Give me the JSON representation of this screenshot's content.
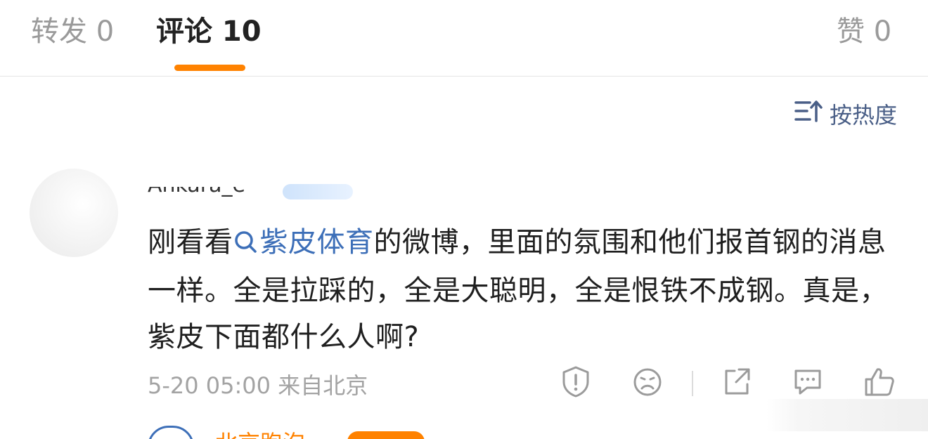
{
  "tabs": {
    "repost": "转发 0",
    "comments": "评论 10",
    "likes": "赞 0"
  },
  "sort": {
    "label": "按热度",
    "icon": "sort-hot-icon"
  },
  "comment": {
    "username": "Ankara_e",
    "text_before": "刚看看",
    "topic": "紫皮体育",
    "text_after": "的微博，里面的氛围和他们报首钢的消息一样。全是拉踩的，全是大聪明，全是恨铁不成钢。真是，紫皮下面都什么人啊?",
    "time": "5-20 05:00",
    "location": "来自北京"
  },
  "next_comment": {
    "username_partial": "北京跑泡"
  },
  "colors": {
    "accent": "#ff8200",
    "link": "#3d6fb8",
    "sort": "#4a5f87",
    "muted": "#a3a3a3"
  },
  "icons": [
    "report-icon",
    "dislike-face-icon",
    "share-icon",
    "comment-icon",
    "like-icon"
  ]
}
